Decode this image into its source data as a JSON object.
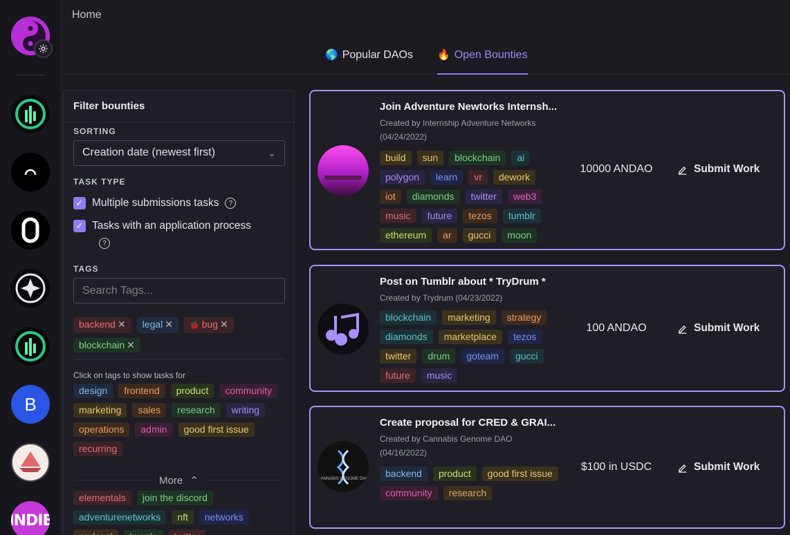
{
  "header": {
    "breadcrumb": "Home",
    "tabs": [
      {
        "label": "Popular DAOs",
        "icon": "🌎"
      },
      {
        "label": "Open Bounties",
        "icon": "🔥"
      }
    ]
  },
  "rail": {
    "b_label": "B",
    "indie_label": "INDIE"
  },
  "filter": {
    "title": "Filter bounties",
    "sorting_label": "SORTING",
    "sorting_value": "Creation date (newest first)",
    "task_type_label": "TASK TYPE",
    "task_types": [
      {
        "label": "Multiple submissions tasks",
        "checked": true
      },
      {
        "label": "Tasks with an application process",
        "checked": true
      }
    ],
    "tags_label": "TAGS",
    "search_placeholder": "Search Tags...",
    "selected_tags": [
      {
        "label": "backend",
        "color": "red"
      },
      {
        "label": "legal",
        "color": "blue"
      },
      {
        "label": "bug",
        "color": "red",
        "icon": "🐞"
      },
      {
        "label": "blockchain",
        "color": "green"
      }
    ],
    "hint": "Click on tags to show tasks for",
    "suggested_tags": [
      {
        "label": "design",
        "color": "blue"
      },
      {
        "label": "frontend",
        "color": "orange"
      },
      {
        "label": "product",
        "color": "lime"
      },
      {
        "label": "community",
        "color": "pink"
      },
      {
        "label": "marketing",
        "color": "yellow"
      },
      {
        "label": "sales",
        "color": "orange"
      },
      {
        "label": "research",
        "color": "green"
      },
      {
        "label": "writing",
        "color": "purple"
      },
      {
        "label": "operations",
        "color": "orange"
      },
      {
        "label": "admin",
        "color": "pink"
      },
      {
        "label": "good first issue",
        "color": "yellow"
      },
      {
        "label": "recurring",
        "color": "red"
      }
    ],
    "more_label": "More",
    "extra_tags": [
      {
        "label": "elementals",
        "color": "red"
      },
      {
        "label": "join the discord",
        "color": "green"
      },
      {
        "label": "adventurenetworks",
        "color": "teal"
      },
      {
        "label": "nft",
        "color": "lime"
      },
      {
        "label": "networks",
        "color": "indigo"
      },
      {
        "label": "podcast",
        "color": "brown"
      },
      {
        "label": "tweets",
        "color": "green"
      },
      {
        "label": "twitter",
        "color": "red"
      }
    ]
  },
  "bounties": [
    {
      "title": "Join Adventure Newtorks Internsh...",
      "creator_line1": "Created by Internship Adventure Networks",
      "creator_line2": "(04/24/2022)",
      "reward": "10000 ANDAO",
      "submit_label": "Submit Work",
      "tags": [
        {
          "label": "build",
          "color": "yellow"
        },
        {
          "label": "sun",
          "color": "yellow"
        },
        {
          "label": "blockchain",
          "color": "green"
        },
        {
          "label": "ai",
          "color": "teal"
        },
        {
          "label": "polygon",
          "color": "purple"
        },
        {
          "label": "learn",
          "color": "indigo"
        },
        {
          "label": "vr",
          "color": "red"
        },
        {
          "label": "dework",
          "color": "yellow"
        },
        {
          "label": "iot",
          "color": "orange"
        },
        {
          "label": "diamonds",
          "color": "green"
        },
        {
          "label": "twitter",
          "color": "purple"
        },
        {
          "label": "web3",
          "color": "magenta"
        },
        {
          "label": "music",
          "color": "red"
        },
        {
          "label": "future",
          "color": "purple"
        },
        {
          "label": "tezos",
          "color": "orange"
        },
        {
          "label": "tumblr",
          "color": "teal"
        },
        {
          "label": "ethereum",
          "color": "lime"
        },
        {
          "label": "ar",
          "color": "orange"
        },
        {
          "label": "gucci",
          "color": "yellow"
        },
        {
          "label": "moon",
          "color": "green"
        }
      ]
    },
    {
      "title": "Post on Tumblr about * TryDrum *",
      "creator_line1": "Created by Trydrum (04/23/2022)",
      "creator_line2": "",
      "reward": "100 ANDAO",
      "submit_label": "Submit Work",
      "tags": [
        {
          "label": "blockchain",
          "color": "teal"
        },
        {
          "label": "marketing",
          "color": "yellow"
        },
        {
          "label": "strategy",
          "color": "orange"
        },
        {
          "label": "diamonds",
          "color": "teal"
        },
        {
          "label": "marketplace",
          "color": "yellow"
        },
        {
          "label": "tezos",
          "color": "indigo"
        },
        {
          "label": "twitter",
          "color": "yellow"
        },
        {
          "label": "drum",
          "color": "green"
        },
        {
          "label": "goteam",
          "color": "indigo"
        },
        {
          "label": "gucci",
          "color": "teal"
        },
        {
          "label": "future",
          "color": "red"
        },
        {
          "label": "music",
          "color": "purple"
        }
      ]
    },
    {
      "title": "Create proposal for CRED & GRAI...",
      "creator_line1": "Created by Cannabis Genome DAO",
      "creator_line2": "(04/16/2022)",
      "reward": "$100 in USDC",
      "submit_label": "Submit Work",
      "tags": [
        {
          "label": "backend",
          "color": "blue"
        },
        {
          "label": "product",
          "color": "lime"
        },
        {
          "label": "good first issue",
          "color": "yellow"
        },
        {
          "label": "community",
          "color": "pink"
        },
        {
          "label": "research",
          "color": "brown"
        }
      ]
    }
  ]
}
